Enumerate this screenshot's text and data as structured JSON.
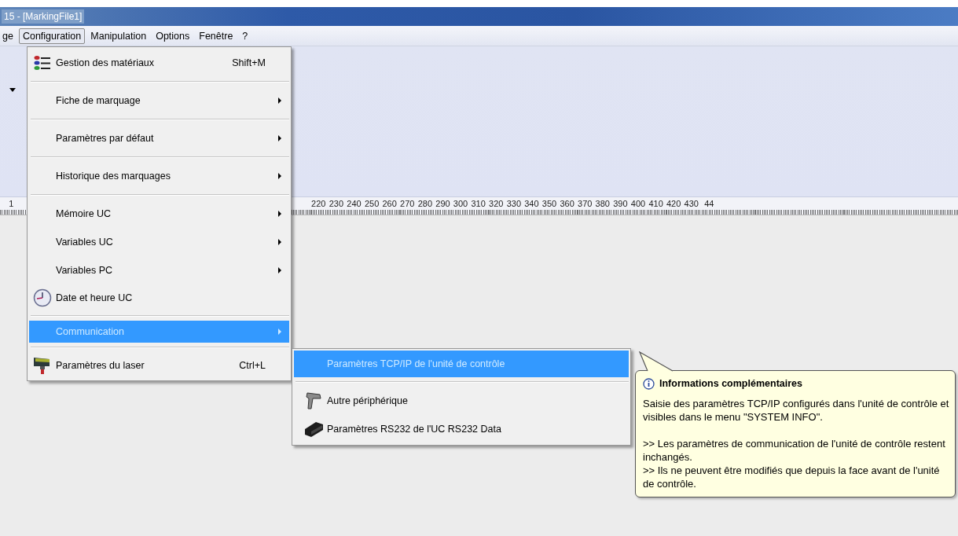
{
  "window": {
    "title": "15 - [MarkingFile1]"
  },
  "menu_bar": [
    {
      "label": "ge",
      "selected": false
    },
    {
      "label": "Configuration",
      "selected": true
    },
    {
      "label": "Manipulation",
      "selected": false
    },
    {
      "label": "Options",
      "selected": false
    },
    {
      "label": "Fenêtre",
      "selected": false
    },
    {
      "label": "?",
      "selected": false
    }
  ],
  "ruler": {
    "left_labels": [
      "1"
    ],
    "labels": [
      "220",
      "230",
      "240",
      "250",
      "260",
      "270",
      "280",
      "290",
      "300",
      "310",
      "320",
      "330",
      "340",
      "350",
      "360",
      "370",
      "380",
      "390",
      "400",
      "410",
      "420",
      "430",
      "44"
    ]
  },
  "configuration_menu": [
    {
      "kind": "item",
      "label": "Gestion des matériaux",
      "shortcut": "Shift+M",
      "has_submenu": false,
      "selected": false
    },
    {
      "kind": "separator"
    },
    {
      "kind": "item",
      "label": "Fiche de marquage",
      "has_submenu": true,
      "selected": false
    },
    {
      "kind": "separator"
    },
    {
      "kind": "item",
      "label": "Paramètres par défaut",
      "has_submenu": true,
      "selected": false
    },
    {
      "kind": "separator"
    },
    {
      "kind": "item",
      "label": "Historique des marquages",
      "has_submenu": true,
      "selected": false
    },
    {
      "kind": "separator"
    },
    {
      "kind": "item",
      "label": "Mémoire UC",
      "has_submenu": true,
      "selected": false
    },
    {
      "kind": "item",
      "label": "Variables UC",
      "has_submenu": true,
      "selected": false
    },
    {
      "kind": "item",
      "label": "Variables PC",
      "has_submenu": true,
      "selected": false
    },
    {
      "kind": "item",
      "label": "Date et heure UC",
      "has_submenu": false,
      "selected": false
    },
    {
      "kind": "separator"
    },
    {
      "kind": "item",
      "label": "Communication",
      "has_submenu": true,
      "selected": true
    },
    {
      "kind": "separator"
    },
    {
      "kind": "item",
      "label": "Paramètres du laser",
      "shortcut": "Ctrl+L",
      "has_submenu": false,
      "selected": false
    }
  ],
  "communication_submenu": [
    {
      "kind": "item",
      "label": "Paramètres TCP/IP de l'unité de contrôle",
      "has_submenu": false,
      "selected": true
    },
    {
      "kind": "separator"
    },
    {
      "kind": "item",
      "label": "Autre périphérique",
      "has_submenu": false,
      "selected": false
    },
    {
      "kind": "item",
      "label": "Paramètres RS232 de l'UC RS232 Data",
      "has_submenu": false,
      "selected": false
    }
  ],
  "info_balloon": {
    "title": "Informations complémentaires",
    "description": "Saisie des paramètres TCP/IP configurés dans l'unité de contrôle et visibles dans le menu \"SYSTEM INFO\".",
    "notes": [
      ">> Les paramètres de communication de l'unité de contrôle restent inchangés.",
      ">> Ils ne peuvent être modifiés que depuis la face avant de l'unité de contrôle."
    ]
  }
}
